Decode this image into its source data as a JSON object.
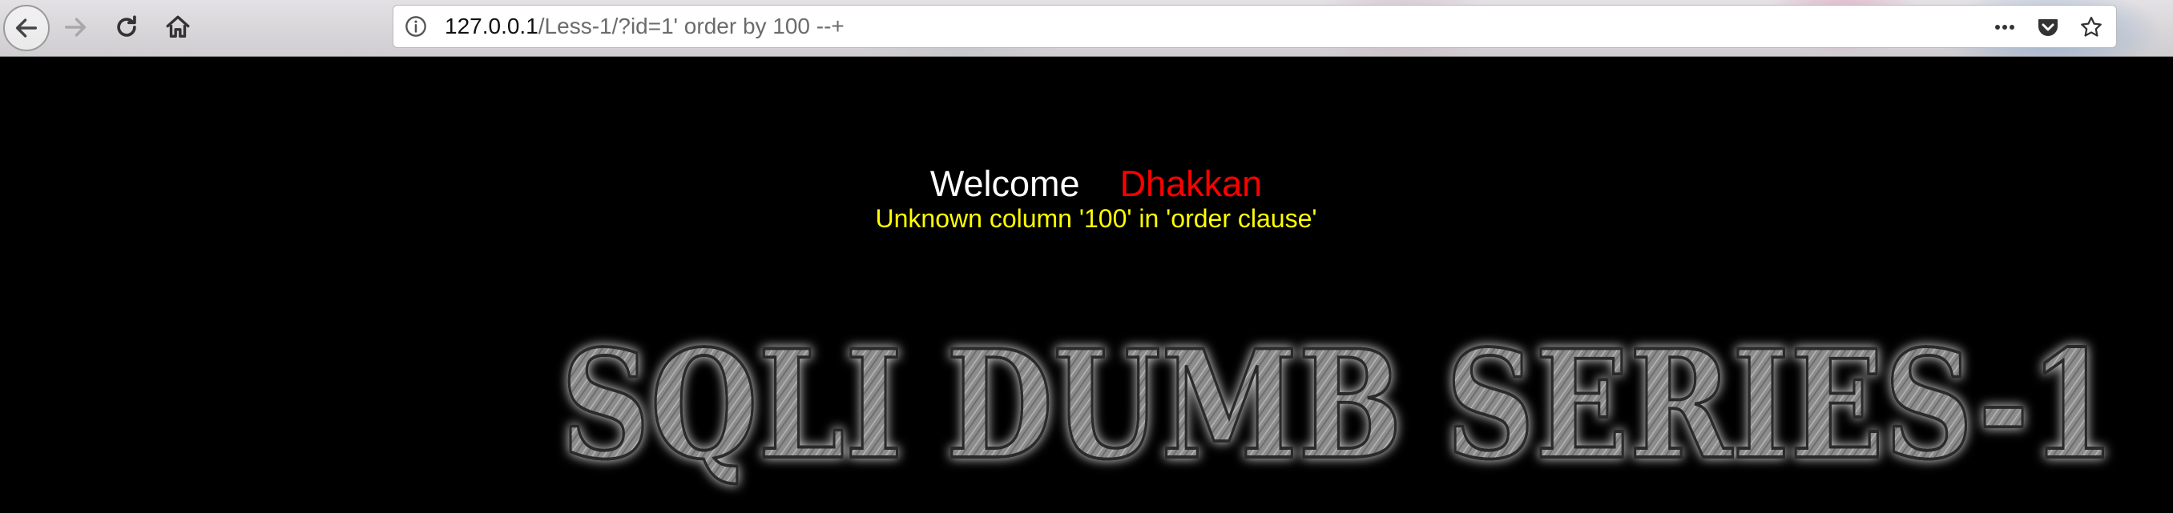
{
  "browser": {
    "nav": {
      "back_icon": "back-arrow-icon",
      "forward_icon": "forward-arrow-icon",
      "reload_icon": "reload-icon",
      "home_icon": "home-icon"
    },
    "url": {
      "host": "127.0.0.1",
      "path": "/Less-1/?id=1' order by 100 --+",
      "info_icon": "info-icon"
    },
    "right_icons": [
      "page-actions-icon",
      "pocket-icon",
      "bookmark-star-icon"
    ]
  },
  "page": {
    "welcome_label": "Welcome",
    "username": "Dhakkan",
    "error_message": "Unknown column '100' in 'order clause'",
    "banner_text": "SQLI DUMB SERIES-1"
  },
  "colors": {
    "background": "#000000",
    "welcome": "#ffffff",
    "username": "#ff0000",
    "error": "#ffff00",
    "banner_fill": "#8c8c8c"
  }
}
